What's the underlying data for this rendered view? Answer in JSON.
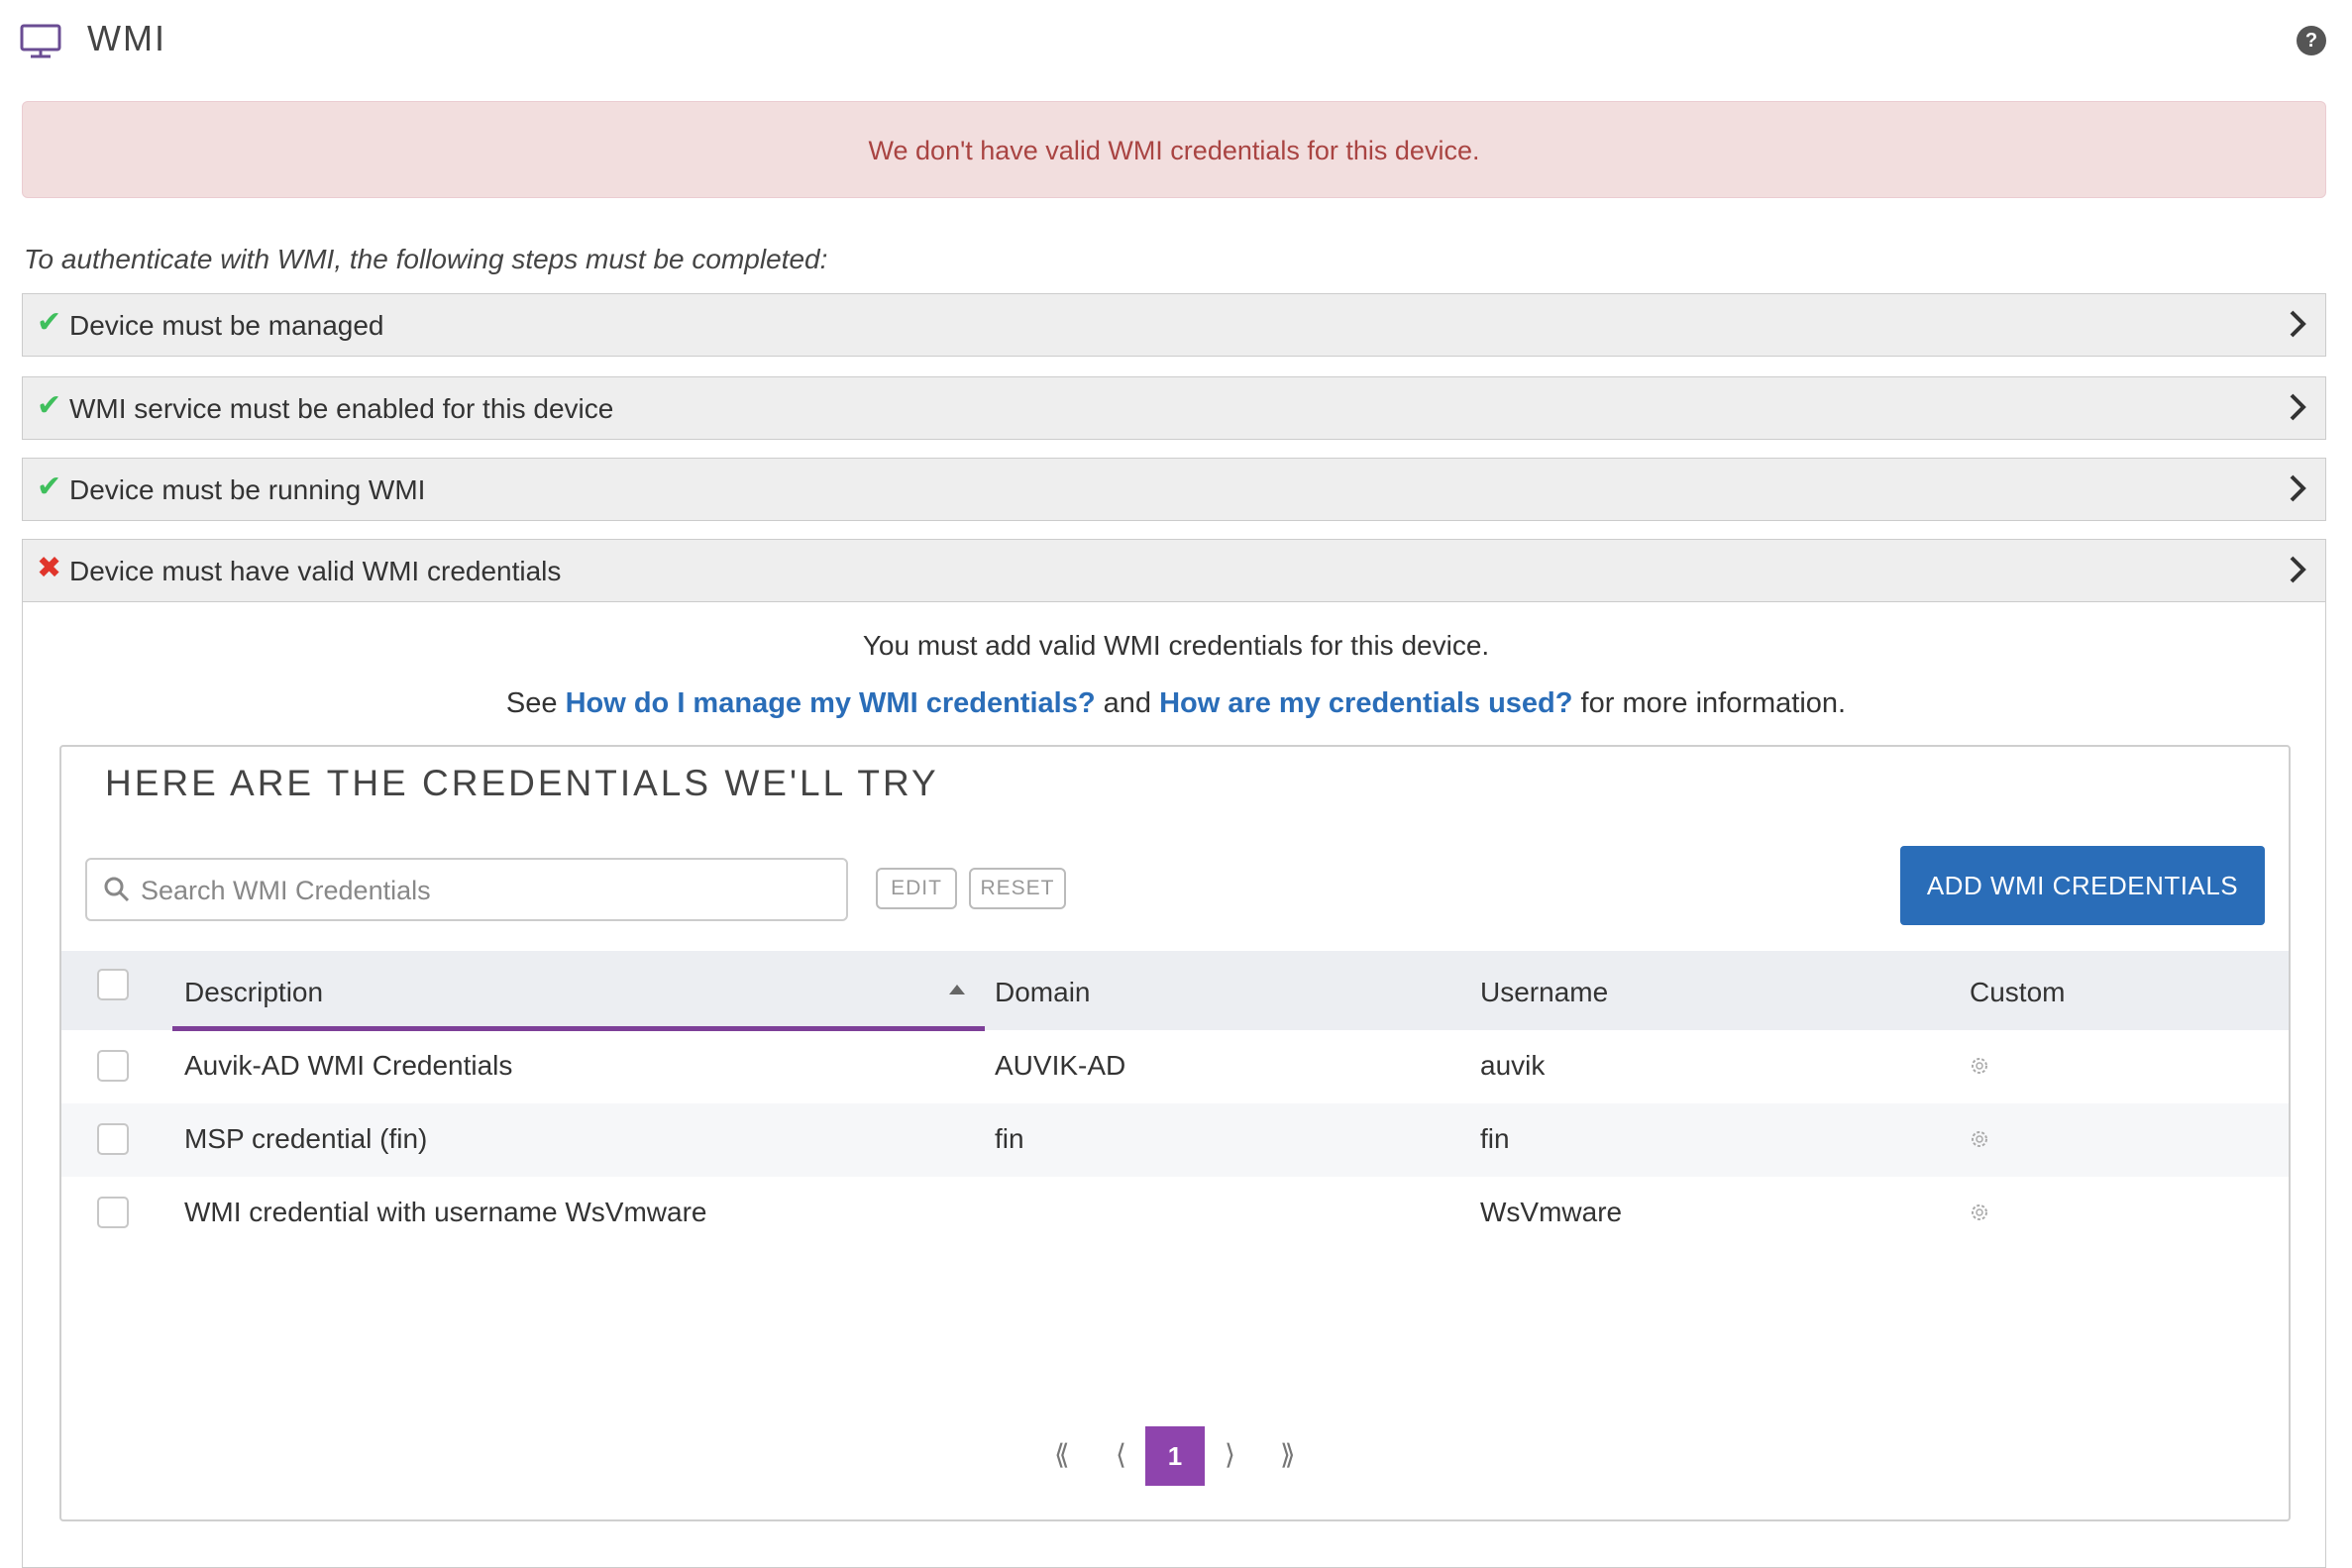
{
  "header": {
    "title": "WMI",
    "help_label": "?"
  },
  "alert": {
    "text": "We don't have valid WMI credentials for this device."
  },
  "intro": "To authenticate with WMI, the following steps must be completed:",
  "steps": [
    {
      "label": "Device must be managed",
      "status": "ok",
      "icon": "check-icon"
    },
    {
      "label": "WMI service must be enabled for this device",
      "status": "ok",
      "icon": "check-icon"
    },
    {
      "label": "Device must be running WMI",
      "status": "ok",
      "icon": "check-icon"
    },
    {
      "label": "Device must have valid WMI credentials",
      "status": "fail",
      "icon": "x-icon"
    }
  ],
  "panel": {
    "message": "You must add valid WMI credentials for this device.",
    "see_prefix": "See ",
    "link1": "How do I manage my WMI credentials?",
    "and_text": " and ",
    "link2": "How are my credentials used?",
    "see_suffix": " for more information."
  },
  "credentials": {
    "title": "HERE ARE THE CREDENTIALS WE'LL TRY",
    "search_placeholder": "Search WMI Credentials",
    "edit_label": "EDIT",
    "reset_label": "RESET",
    "add_label": "ADD WMI CREDENTIALS",
    "columns": [
      "Description",
      "Domain",
      "Username",
      "Custom"
    ],
    "rows": [
      {
        "description": "Auvik-AD WMI Credentials",
        "domain": "AUVIK-AD",
        "username": "auvik",
        "custom_icon": "gear-icon"
      },
      {
        "description": "MSP credential (fin)",
        "domain": "fin",
        "username": "fin",
        "custom_icon": "gear-icon"
      },
      {
        "description": "WMI credential with username WsVmware",
        "domain": "",
        "username": "WsVmware",
        "custom_icon": "gear-icon"
      }
    ],
    "pagination": {
      "first": "⟪",
      "prev": "⟨",
      "current": "1",
      "next": "⟩",
      "last": "⟫"
    }
  },
  "colors": {
    "accent_blue": "#2a6db8",
    "accent_purple": "#8e44ad",
    "alert_bg": "#f2dede",
    "alert_text": "#a94442",
    "ok_green": "#3fbf5c",
    "fail_red": "#e0352b"
  }
}
